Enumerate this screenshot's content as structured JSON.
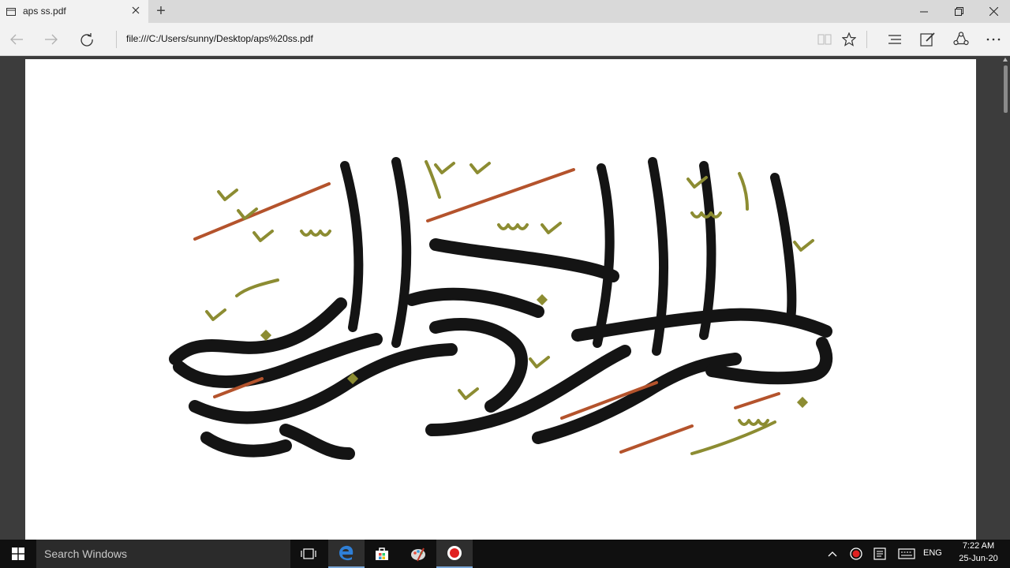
{
  "browser": {
    "tab_title": "aps ss.pdf",
    "new_tab_symbol": "+",
    "url": "file:///C:/Users/sunny/Desktop/aps%20ss.pdf",
    "icons": [
      "page-icon",
      "close-icon",
      "minimize-icon",
      "maximize-icon",
      "back-icon",
      "forward-icon",
      "refresh-icon",
      "reading-view-icon",
      "favorite-star-icon",
      "hub-icon",
      "web-note-icon",
      "share-icon",
      "more-icon"
    ]
  },
  "document": {
    "artwork": "Arabic calligraphy image",
    "colors": {
      "ink": "#141414",
      "olive": "#8c8c32",
      "rust": "#b4532c"
    }
  },
  "taskbar": {
    "search_placeholder": "Search Windows",
    "language": "ENG",
    "time": "7:22 AM",
    "date": "25-Jun-20",
    "icons": [
      "windows-start-icon",
      "task-view-icon",
      "edge-icon",
      "store-icon",
      "paint-icon",
      "recorder-icon",
      "chevron-up-icon",
      "record-tray-icon",
      "notes-tray-icon",
      "keyboard-tray-icon"
    ]
  }
}
